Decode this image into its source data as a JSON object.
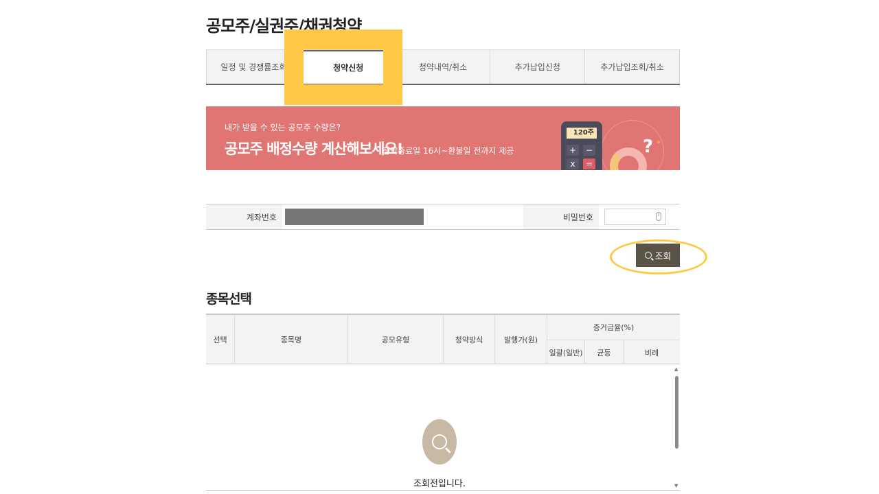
{
  "page_title": "공모주/실권주/채권청약",
  "tabs": [
    {
      "label": "일정 및 경쟁률조회",
      "active": false
    },
    {
      "label": "청약신청",
      "active": true
    },
    {
      "label": "청약내역/취소",
      "active": false
    },
    {
      "label": "추가납입신청",
      "active": false
    },
    {
      "label": "추가납입조회/취소",
      "active": false
    }
  ],
  "banner": {
    "small_text": "내가 받을 수 있는 공모주 수량은?",
    "headline": "공모주 배정수량 계산해보세요!",
    "note": "청약종료일 16시~환불일 전까지 제공",
    "calc_display": "120주",
    "calc_keys": [
      "+",
      "−",
      "x",
      "="
    ],
    "question_mark": "?",
    "background_color": "#e17573"
  },
  "account_row": {
    "account_label": "계좌번호",
    "password_label": "비밀번호"
  },
  "search_button": {
    "label": "조회"
  },
  "section_title": "종목선택",
  "table": {
    "headers": {
      "select": "선택",
      "name": "종목명",
      "offering_type": "공모유형",
      "subscription_method": "청약방식",
      "issue_price": "발행가(원)",
      "margin_rate": "증거금율(%)",
      "lump": "일괄(일반)",
      "equal": "균등",
      "proportional": "비례"
    },
    "empty_message": "조회전입니다."
  },
  "colors": {
    "highlight": "#ffc947",
    "button_dark": "#5b5346",
    "tab_bottom_border": "#6b6358",
    "empty_icon": "#c8b9a5"
  }
}
